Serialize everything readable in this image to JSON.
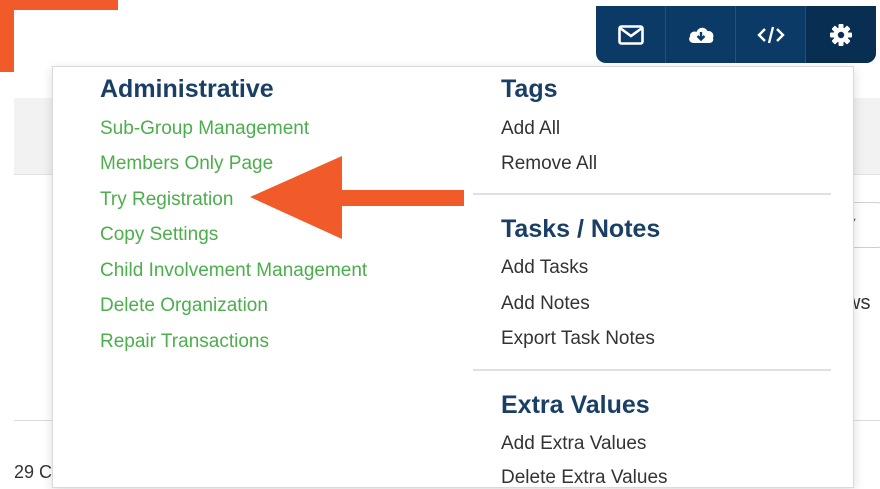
{
  "toolbar": {
    "buttons": [
      {
        "icon": "envelope-icon"
      },
      {
        "icon": "cloud-download-icon"
      },
      {
        "icon": "code-icon"
      },
      {
        "icon": "gear-icon"
      }
    ]
  },
  "menu": {
    "administrative": {
      "title": "Administrative",
      "items": [
        "Sub-Group Management",
        "Members Only Page",
        "Try Registration",
        "Copy Settings",
        "Child Involvement Management",
        "Delete Organization",
        "Repair Transactions"
      ]
    },
    "tags": {
      "title": "Tags",
      "items": [
        "Add All",
        "Remove All"
      ]
    },
    "tasks_notes": {
      "title": "Tasks / Notes",
      "items": [
        "Add Tasks",
        "Add Notes",
        "Export Task Notes"
      ]
    },
    "extra_values": {
      "title": "Extra Values",
      "items": [
        "Add Extra Values",
        "Delete Extra Values"
      ]
    }
  },
  "background": {
    "right_fragment": "ws",
    "bottom_fragment": "29 C"
  },
  "colors": {
    "toolbar": "#0b3a66",
    "heading": "#1a3f66",
    "link": "#4cae4c",
    "arrow": "#f15a29"
  }
}
